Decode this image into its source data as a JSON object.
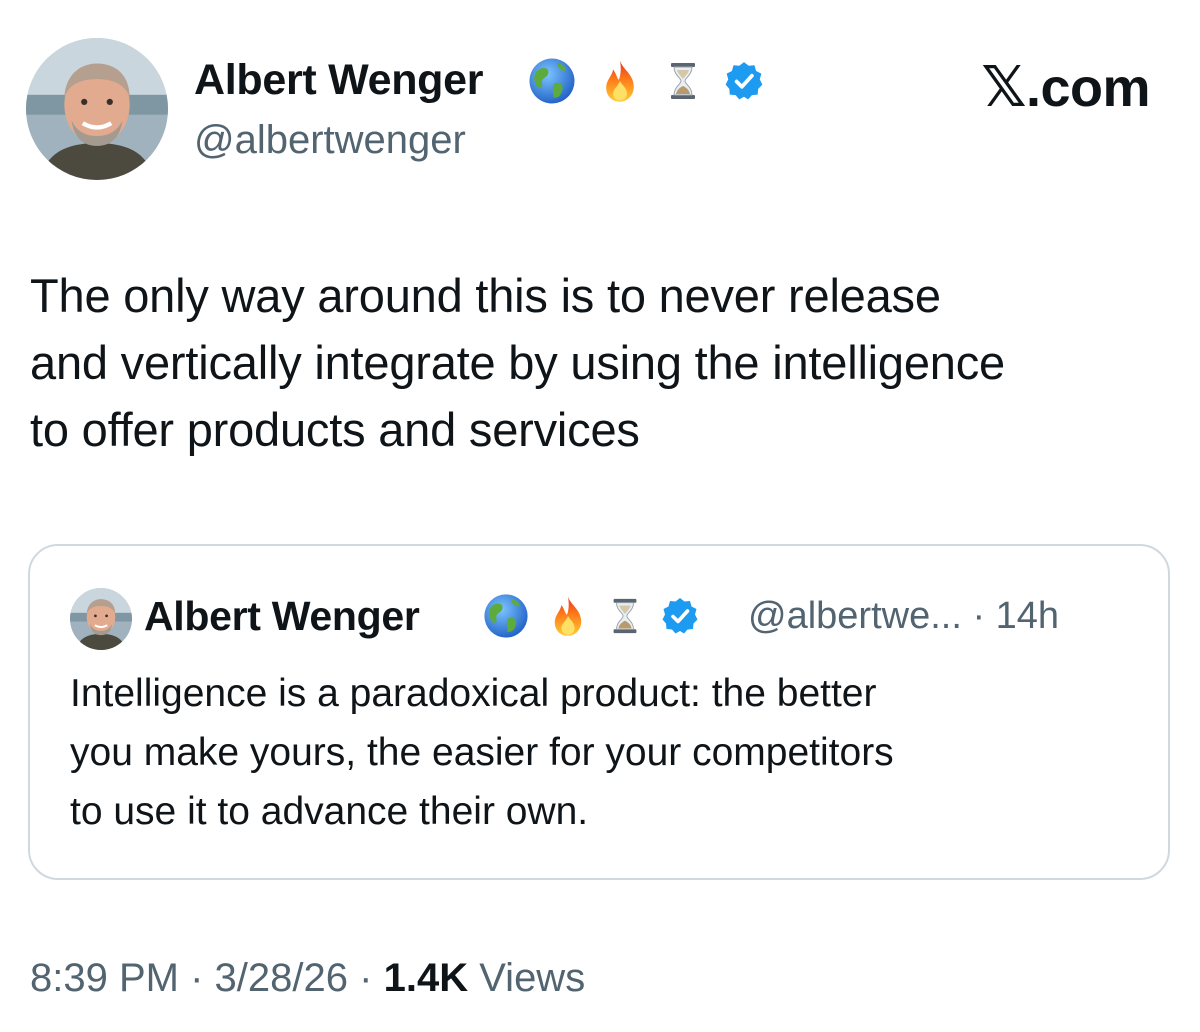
{
  "tweet": {
    "author_name": "Albert Wenger",
    "author_handle": "@albertwenger",
    "emoji_icons": [
      "globe-americas-icon",
      "fire-icon",
      "hourglass-icon",
      "verified-badge-icon"
    ],
    "text_lines": [
      "The only way around this is to never release",
      "and vertically integrate by using the intelligence",
      "to offer products and services"
    ]
  },
  "brand": {
    "x_symbol": "𝕏",
    "domain": ".com"
  },
  "quoted_tweet": {
    "author_name": "Albert Wenger",
    "handle_and_time": "@albertwe... · 14h",
    "text_lines": [
      "Intelligence is a paradoxical product: the better",
      "you make yours, the easier for your competitors",
      "to use it to advance their own."
    ]
  },
  "meta": {
    "time": "8:39 PM",
    "separator": "·",
    "date": "3/28/26",
    "views_count": "1.4K",
    "views_label": "Views"
  },
  "colors": {
    "text": "#0f1419",
    "secondary": "#536471",
    "border": "#cfd9de",
    "verified": "#1d9bf0"
  }
}
